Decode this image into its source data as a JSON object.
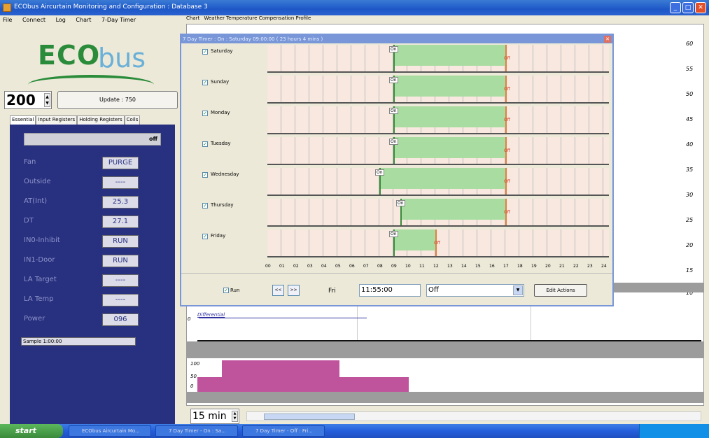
{
  "window": {
    "title": "ECObus Aircurtain Monitoring and Configuration : Database 3"
  },
  "menu": [
    "File",
    "Connect",
    "Log",
    "Chart",
    "7-Day Timer"
  ],
  "logo": {
    "eco": "ECO",
    "bus": "bus"
  },
  "left": {
    "address_value": "200",
    "update_label": "Update : 750",
    "tabs": [
      "Essential",
      "Input Registers",
      "Holding Registers",
      "Coils"
    ],
    "status_off": "off",
    "rows": [
      {
        "label": "Fan",
        "value": "PURGE"
      },
      {
        "label": "Outside",
        "value": "----"
      },
      {
        "label": "AT(Int)",
        "value": "25.3"
      },
      {
        "label": "DT",
        "value": "27.1"
      },
      {
        "label": "IN0-Inhibit",
        "value": "RUN"
      },
      {
        "label": "IN1-Door",
        "value": "RUN"
      },
      {
        "label": "LA Target",
        "value": "----"
      },
      {
        "label": "LA Temp",
        "value": "----"
      },
      {
        "label": "Power",
        "value": "096"
      }
    ],
    "sample": "Sample 1:00:00"
  },
  "right_tabs": [
    "Chart",
    "Weather Temperature Compensation Profile"
  ],
  "y_axis_labels": [
    "60",
    "55",
    "50",
    "45",
    "40",
    "35",
    "30",
    "25",
    "20",
    "15",
    "10"
  ],
  "diff_label": "Differential",
  "lower_chart_labels": [
    "100",
    "50",
    "0"
  ],
  "small_zero": "0",
  "interval": "15 min",
  "dialog": {
    "title": "7 Day Timer : On : Saturday 09:00:00 ( 23 hours 4 mins )",
    "days": [
      "Saturday",
      "Sunday",
      "Monday",
      "Tuesday",
      "Wednesday",
      "Thursday",
      "Friday"
    ],
    "on_label": "On",
    "off_label": "Off",
    "hours": [
      "00",
      "01",
      "02",
      "03",
      "04",
      "05",
      "06",
      "07",
      "08",
      "09",
      "10",
      "11",
      "12",
      "13",
      "14",
      "15",
      "16",
      "17",
      "18",
      "19",
      "20",
      "21",
      "22",
      "23",
      "24"
    ],
    "run_label": "Run",
    "prev_label": "<<",
    "next_label": ">>",
    "day_short": "Fri",
    "time_value": "11:55:00",
    "action_value": "Off",
    "edit_label": "Edit Actions",
    "schedule_hours": [
      {
        "on": 9.0,
        "off": 17.0
      },
      {
        "on": 9.0,
        "off": 17.0
      },
      {
        "on": 9.0,
        "off": 17.0
      },
      {
        "on": 9.0,
        "off": 17.0
      },
      {
        "on": 8.0,
        "off": 17.0
      },
      {
        "on": 9.5,
        "off": 17.0
      },
      {
        "on": 9.0,
        "off": 12.0
      }
    ]
  },
  "taskbar": {
    "start": "start",
    "items": [
      "ECObus Aircurtain Mo...",
      "7 Day Timer - On : Sa...",
      "7 Day Timer - Off : Fri..."
    ]
  }
}
